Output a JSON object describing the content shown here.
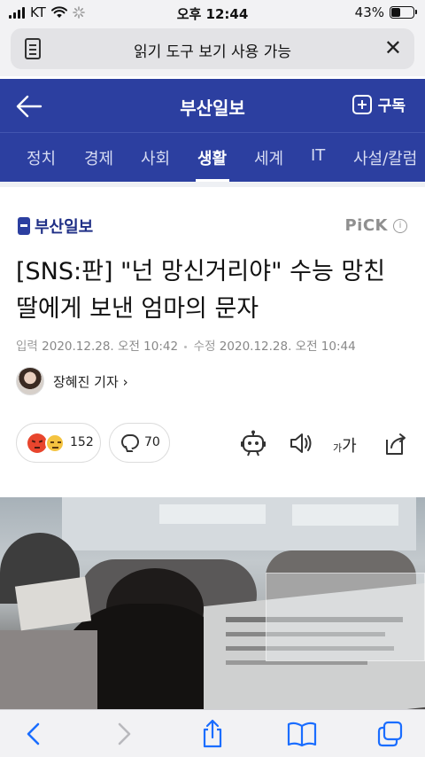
{
  "status_bar": {
    "carrier": "KT",
    "time": "오후 12:44",
    "battery_percent": "43%",
    "battery_level": 0.43
  },
  "reader_bar": {
    "label": "읽기 도구 보기 사용 가능",
    "icons": [
      "reader-document-icon",
      "close-icon"
    ]
  },
  "header": {
    "brand": "부산일보",
    "subscribe_label": "구독",
    "tabs": [
      {
        "label": "정치",
        "active": false
      },
      {
        "label": "경제",
        "active": false
      },
      {
        "label": "사회",
        "active": false
      },
      {
        "label": "생활",
        "active": true
      },
      {
        "label": "세계",
        "active": false
      },
      {
        "label": "IT",
        "active": false
      },
      {
        "label": "사설/칼럼",
        "active": false
      }
    ],
    "background_color": "#2c3fa0"
  },
  "article": {
    "publisher": "부산일보",
    "pick_label": "PiCK",
    "info_label": "i",
    "title": "[SNS:판] \"넌 망신거리야\" 수능 망친 딸에게 보낸 엄마의 문자",
    "published_label": "입력",
    "published_value": "2020.12.28. 오전 10:42",
    "modified_label": "수정",
    "modified_value": "2020.12.28. 오전 10:44",
    "reporter": "장혜진 기자",
    "reporter_chevron": "›",
    "reaction_count": "152",
    "comment_count": "70",
    "font_small": "가",
    "font_large": "가",
    "tools": [
      "summary-bot-icon",
      "read-aloud-icon",
      "font-size-icon",
      "share-icon"
    ]
  },
  "toolbar": {
    "buttons": [
      "back-icon",
      "forward-icon",
      "share-icon",
      "bookmarks-icon",
      "tabs-icon"
    ],
    "accent_color": "#1a6dff"
  }
}
